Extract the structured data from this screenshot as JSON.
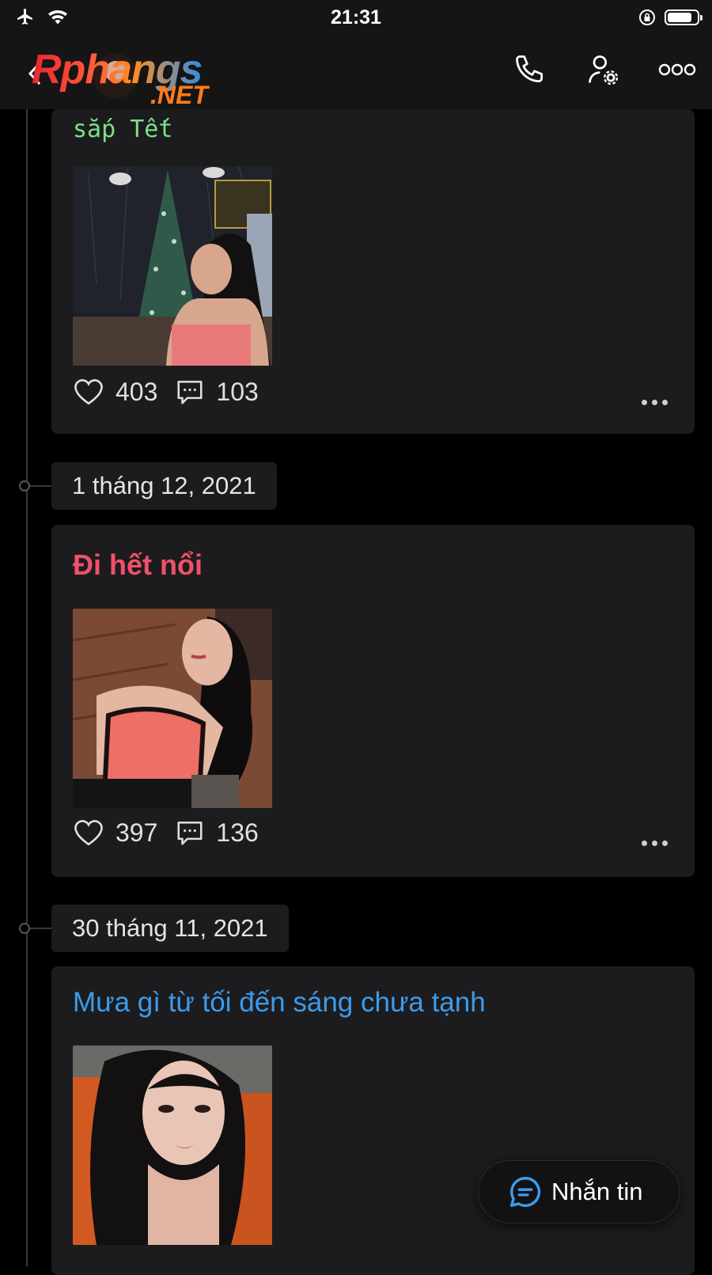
{
  "status_bar": {
    "time": "21:31"
  },
  "header": {
    "logo_text": "Rphangs",
    "logo_suffix": ".NET"
  },
  "posts": [
    {
      "title": "sắp Tết",
      "title_color": "#7ee08a",
      "photo_icon": "photo-woman-christmas-tree",
      "likes": "403",
      "comments": "103"
    },
    {
      "date": "1 tháng 12, 2021",
      "title": "Đi hết nổi",
      "title_color": "#f0506a",
      "photo_icon": "photo-woman-pink-top",
      "likes": "397",
      "comments": "136"
    },
    {
      "date": "30 tháng 11, 2021",
      "title": "Mưa gì từ tối đến sáng chưa tạnh",
      "title_color": "#3d9bea",
      "photo_icon": "photo-woman-portrait"
    }
  ],
  "message_button": {
    "label": "Nhắn tin"
  },
  "colors": {
    "background": "#000000",
    "card": "#1c1c1e",
    "accent_blue": "#3d9bea"
  }
}
